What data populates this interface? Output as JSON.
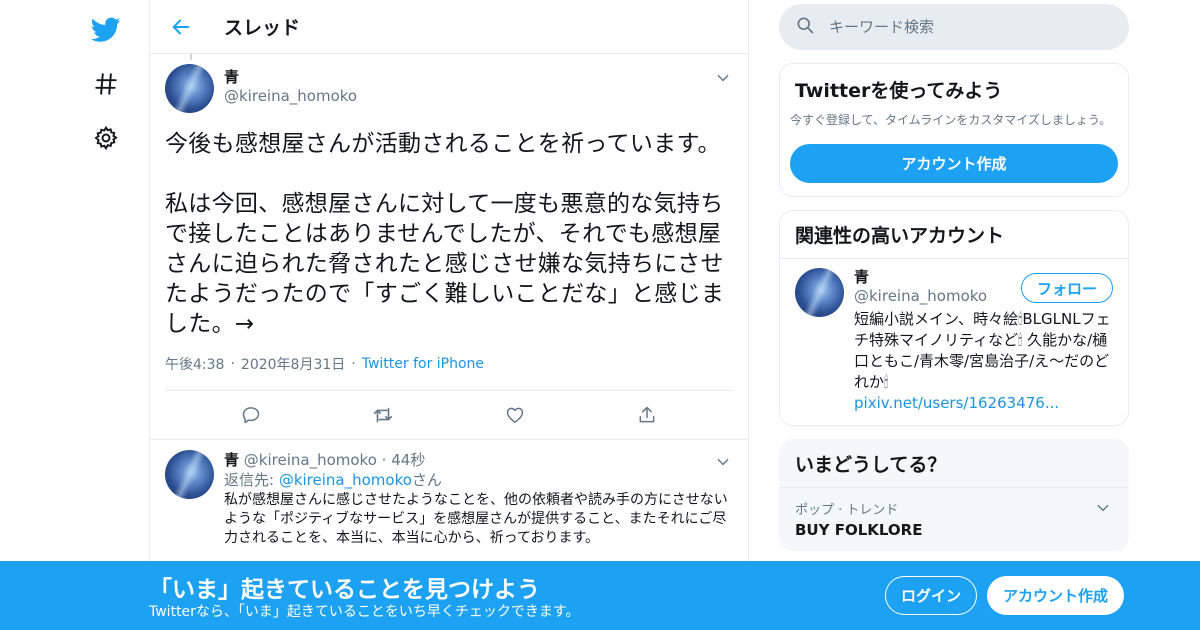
{
  "colors": {
    "accent": "#1da1f2",
    "link": "#1b95e0",
    "muted": "#657786",
    "border": "#e6ecf0"
  },
  "nav": {
    "logo_icon": "twitter-bird-icon",
    "explore_icon": "hashtag-icon",
    "settings_icon": "gear-icon"
  },
  "header": {
    "title": "スレッド",
    "back_icon": "arrow-left-icon"
  },
  "focus_tweet": {
    "display_name": "青",
    "handle": "@kireina_homoko",
    "text": "今後も感想屋さんが活動されることを祈っています。\n\n私は今回、感想屋さんに対して一度も悪意的な気持ちで接したことはありませんでしたが、それでも感想屋さんに迫られた脅されたと感じさせ嫌な気持ちにさせたようだったので「すごく難しいことだな」と感じました。→",
    "time": "午後4:38",
    "date": "2020年8月31日",
    "source": "Twitter for iPhone",
    "sep": "·",
    "actions": [
      "reply-icon",
      "retweet-icon",
      "like-icon",
      "share-icon"
    ]
  },
  "reply_tweet": {
    "display_name": "青",
    "handle": "@kireina_homoko",
    "sep": "·",
    "time": "44秒",
    "reply_prefix": "返信先: ",
    "reply_handle": "@kireina_homoko",
    "reply_suffix": "さん",
    "text": "私が感想屋さんに感じさせたようなことを、他の依頼者や読み手の方にさせないような「ポジティブなサービス」を感想屋さんが提供すること、またそれにご尽力されることを、本当に、本当に心から、祈っております。"
  },
  "search": {
    "placeholder": "キーワード検索"
  },
  "signup_card": {
    "title": "Twitterを使ってみよう",
    "description": "今すぐ登録して、タイムラインをカスタマイズしましょう。",
    "button": "アカウント作成"
  },
  "related_card": {
    "title": "関連性の高いアカウント",
    "display_name": "青",
    "handle": "@kireina_homoko",
    "follow_button": "フォロー",
    "bio": "短編小説メイン、時々絵🕯BLGLNLフェチ特殊マイノリティなど🕯 久能かな/樋口ともこ/青木零/宮島治子/え〜だのどれか🕯",
    "bio_link": "pixiv.net/users/16263476..."
  },
  "trends_card": {
    "title": "いまどうしてる？",
    "category": "ポップ · トレンド",
    "name": "BUY FOLKLORE"
  },
  "banner": {
    "title": "「いま」起きていることを見つけよう",
    "subtitle": "Twitterなら、「いま」起きていることをいち早くチェックできます。",
    "login": "ログイン",
    "signup": "アカウント作成"
  }
}
